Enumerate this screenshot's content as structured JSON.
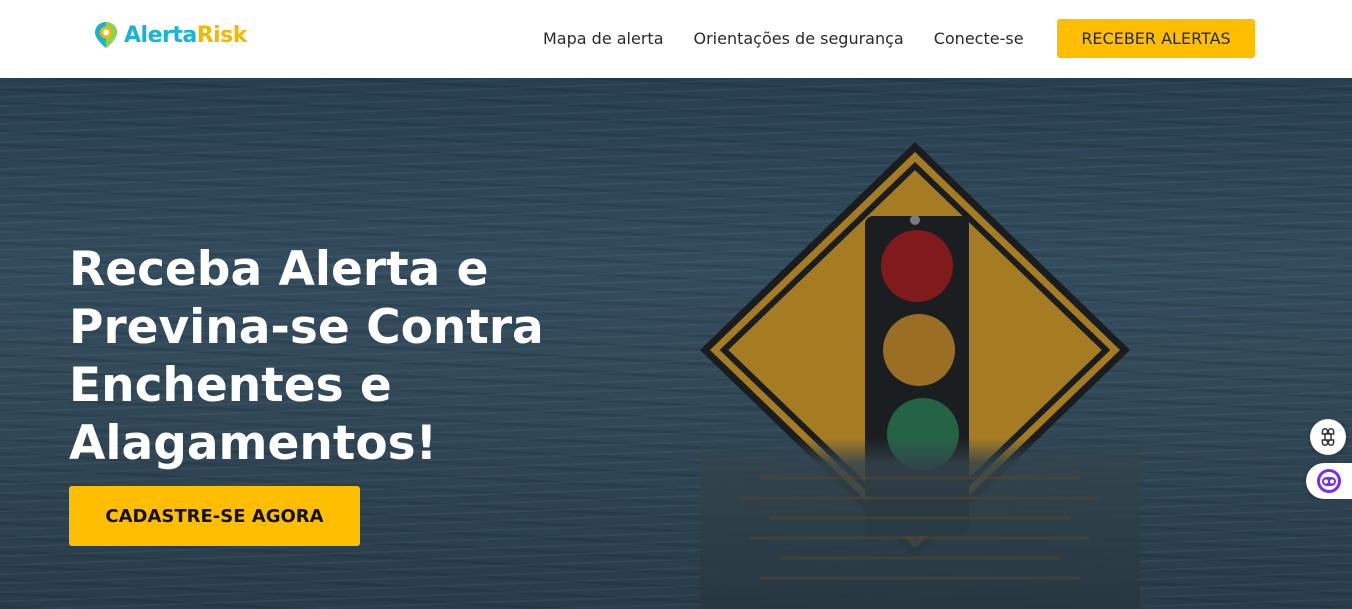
{
  "brand": {
    "name_part1": "Alerta",
    "name_part2": "Risk",
    "color1": "#17b3d9",
    "color2": "#f5b800"
  },
  "nav": {
    "links": [
      "Mapa de alerta",
      "Orientações de segurança",
      "Conecte-se"
    ],
    "cta_label": "RECEBER ALERTAS"
  },
  "hero": {
    "title": "Receba Alerta e Previna-se Contra Enchentes e Alagamentos!",
    "cta_label": "CADASTRE-SE AGORA",
    "accent": "#ffbe00"
  },
  "side_widgets": {
    "icons": [
      "command-icon",
      "chat-bot-icon"
    ]
  }
}
